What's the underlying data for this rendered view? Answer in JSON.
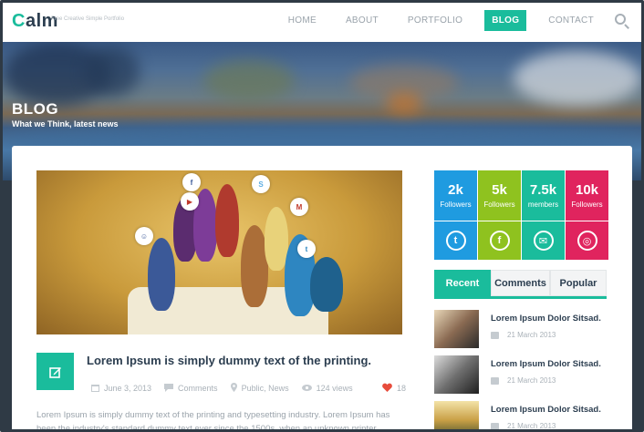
{
  "header": {
    "logo": {
      "prefix": "C",
      "rest": "alm"
    },
    "tagline": "Free Creative Simple Portfolio",
    "nav": [
      "HOME",
      "ABOUT",
      "PORTFOLIO",
      "BLOG",
      "CONTACT"
    ],
    "active_nav": "BLOG",
    "search_icon": "search-icon"
  },
  "hero": {
    "title": "BLOG",
    "subtitle": "What we Think, latest news"
  },
  "post": {
    "title": "Lorem Ipsum is simply dummy text of the printing.",
    "date": "June 3, 2013",
    "comments_label": "Comments",
    "categories": "Public, News",
    "views": "124 views",
    "likes": "18",
    "excerpt": "Lorem Ipsum is simply dummy text of the printing and typesetting industry. Lorem Ipsum has been the industry's standard dummy text ever since the 1500s, when an unknown printer"
  },
  "social": [
    {
      "count": "2k",
      "label": "Followers",
      "network": "twitter-icon",
      "glyph": "t",
      "color": "#1f9be0"
    },
    {
      "count": "5k",
      "label": "Followers",
      "network": "facebook-icon",
      "glyph": "f",
      "color": "#8fc21f"
    },
    {
      "count": "7.5k",
      "label": "members",
      "network": "email-icon",
      "glyph": "✉",
      "color": "#1abc9c"
    },
    {
      "count": "10k",
      "label": "Followers",
      "network": "dribbble-icon",
      "glyph": "◎",
      "color": "#e0245e"
    }
  ],
  "tabs": [
    "Recent",
    "Comments",
    "Popular"
  ],
  "active_tab": "Recent",
  "recent": [
    {
      "title": "Lorem Ipsum Dolor Sitsad.",
      "date": "21 March 2013"
    },
    {
      "title": "Lorem Ipsum Dolor Sitsad.",
      "date": "21 March 2013"
    },
    {
      "title": "Lorem Ipsum Dolor Sitsad.",
      "date": "21 March 2013"
    }
  ],
  "colors": {
    "accent": "#1abc9c",
    "heading": "#2c3e50",
    "muted": "#a9b1b8",
    "like": "#e74c3c"
  }
}
